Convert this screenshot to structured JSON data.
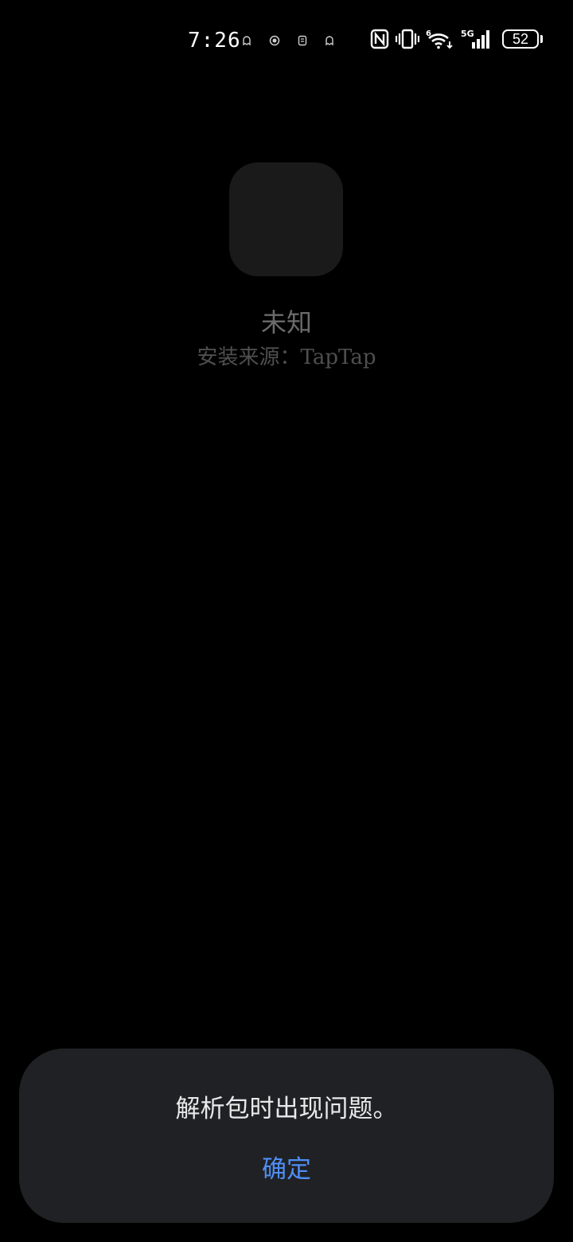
{
  "status_bar": {
    "time": "7:26",
    "notification_icons": [
      "ghost-icon",
      "record-icon",
      "app-icon",
      "ghost-icon"
    ],
    "system_icons": [
      "nfc-icon",
      "vibrate-icon",
      "wifi-6-icon",
      "signal-5g-icon"
    ],
    "battery_level": "52"
  },
  "app": {
    "name": "未知",
    "install_source": "安装来源：TapTap"
  },
  "dialog": {
    "message": "解析包时出现问题。",
    "ok_label": "确定"
  },
  "colors": {
    "background": "#000000",
    "dialog_bg": "#202124",
    "accent": "#4f8ef7",
    "icon_placeholder": "#1a1a1a"
  }
}
